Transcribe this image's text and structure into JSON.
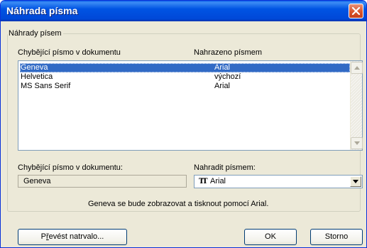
{
  "window": {
    "title": "Náhrada písma"
  },
  "group": {
    "legend": "Náhrady písem"
  },
  "columns": {
    "missing_font": "Chybějící písmo v dokumentu",
    "replaced_by": "Nahrazeno písmem"
  },
  "font_list": {
    "rows": [
      {
        "missing": "Geneva",
        "replacement": "Arial",
        "selected": true
      },
      {
        "missing": "Helvetica",
        "replacement": "výchozí",
        "selected": false
      },
      {
        "missing": "MS Sans Serif",
        "replacement": "Arial",
        "selected": false
      }
    ]
  },
  "missing_field": {
    "label": "Chybějící písmo v dokumentu:",
    "value": "Geneva"
  },
  "replace_field": {
    "label": "Nahradit písmem:",
    "value": "Arial",
    "icon": "truetype-font-icon"
  },
  "status_message": "Geneva se bude zobrazovat a tisknout pomocí Arial.",
  "buttons": {
    "convert_permanently": {
      "pre": "P",
      "acc": "ř",
      "post": "evést natrvalo..."
    },
    "ok": "OK",
    "cancel": "Storno"
  },
  "colors": {
    "titlebar": "#0054e3",
    "selection": "#316ac5",
    "close": "#d9542b",
    "face": "#ece9d8"
  }
}
